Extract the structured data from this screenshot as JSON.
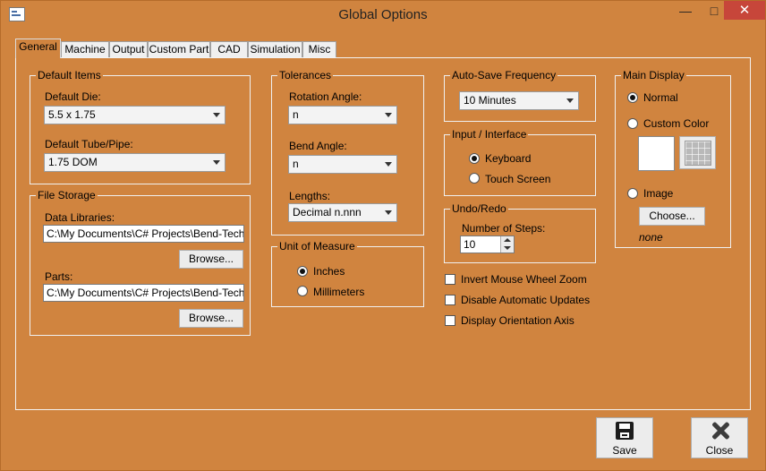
{
  "window": {
    "title": "Global Options"
  },
  "title_buttons": {
    "minimize": "—",
    "maximize": "□",
    "close": "✕"
  },
  "tabs": [
    "General",
    "Machine",
    "Output",
    "Custom Part",
    "CAD",
    "Simulation",
    "Misc"
  ],
  "default_items": {
    "legend": "Default Items",
    "die_label": "Default Die:",
    "die_value": "5.5 x 1.75",
    "tube_label": "Default Tube/Pipe:",
    "tube_value": "1.75 DOM"
  },
  "file_storage": {
    "legend": "File Storage",
    "data_label": "Data Libraries:",
    "data_value": "C:\\My Documents\\C# Projects\\Bend-Tech\\Be",
    "browse1": "Browse...",
    "parts_label": "Parts:",
    "parts_value": "C:\\My Documents\\C# Projects\\Bend-Tech\\Be",
    "browse2": "Browse..."
  },
  "tolerances": {
    "legend": "Tolerances",
    "rotation_label": "Rotation Angle:",
    "rotation_value": "n",
    "bend_label": "Bend Angle:",
    "bend_value": "n",
    "lengths_label": "Lengths:",
    "lengths_value": "Decimal n.nnn"
  },
  "unit_of_measure": {
    "legend": "Unit of Measure",
    "inches": "Inches",
    "millimeters": "Millimeters"
  },
  "autosave": {
    "legend": "Auto-Save Frequency",
    "value": "10 Minutes"
  },
  "input_interface": {
    "legend": "Input / Interface",
    "keyboard": "Keyboard",
    "touch": "Touch Screen"
  },
  "undo_redo": {
    "legend": "Undo/Redo",
    "steps_label": "Number of Steps:",
    "steps_value": "10"
  },
  "options": {
    "invert_mouse": "Invert Mouse Wheel Zoom",
    "disable_updates": "Disable Automatic Updates",
    "display_axis": "Display Orientation Axis"
  },
  "main_display": {
    "legend": "Main Display",
    "normal": "Normal",
    "custom_color": "Custom Color",
    "image": "Image",
    "choose": "Choose...",
    "image_value": "none"
  },
  "footer": {
    "save": "Save",
    "close": "Close"
  },
  "colors": {
    "background": "#d0843f",
    "close_button": "#c7463a"
  }
}
